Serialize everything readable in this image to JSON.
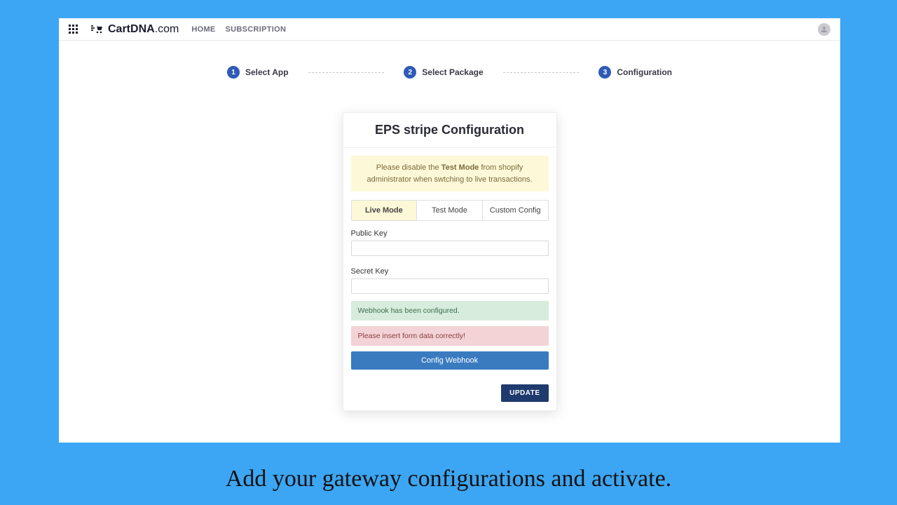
{
  "logo": {
    "brand": "CartDNA",
    "suffix": ".com"
  },
  "nav": {
    "home": "HOME",
    "subscription": "SUBSCRIPTION"
  },
  "stepper": {
    "s1": "Select App",
    "s2": "Select Package",
    "s3": "Configuration"
  },
  "card": {
    "title": "EPS stripe Configuration",
    "warn_prefix": "Please disable the ",
    "warn_bold": "Test Mode",
    "warn_suffix": " from shopify administrator when swtching to live transactions.",
    "tabs": {
      "live": "Live Mode",
      "test": "Test Mode",
      "custom": "Custom Config"
    },
    "form": {
      "public_key_label": "Public Key",
      "public_key_value": "",
      "secret_key_label": "Secret Key",
      "secret_key_value": ""
    },
    "alert_success": "Webhook has been configured.",
    "alert_error": "Please insert form data correctly!",
    "config_btn": "Config Webhook",
    "update_btn": "UPDATE"
  },
  "caption": "Add your gateway configurations and activate."
}
